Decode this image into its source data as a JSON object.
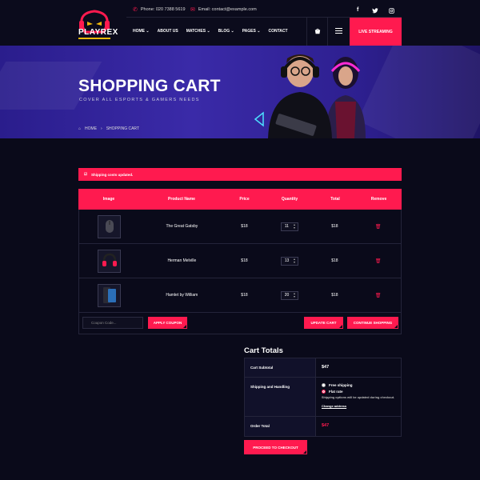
{
  "brand": {
    "name": "PLAYREX"
  },
  "topbar": {
    "phone": "Phone: 020 7388 5619",
    "email": "Email: contact@example.com",
    "social": [
      "facebook-icon",
      "twitter-icon",
      "instagram-icon"
    ]
  },
  "nav": {
    "items": [
      "HOME",
      "ABOUT US",
      "MATCHES",
      "BLOG",
      "PAGES",
      "CONTACT"
    ],
    "live_label": "LIVE STREAMING"
  },
  "hero": {
    "title": "SHOPPING CART",
    "subtitle": "COVER ALL ESPORTS & GAMERS NEEDS",
    "breadcrumb": {
      "home": "HOME",
      "current": "SHOPPING CART"
    }
  },
  "notice": "Shipping costs updated.",
  "cart": {
    "headers": [
      "Image",
      "Product Name",
      "Price",
      "Quantity",
      "Total",
      "Remove"
    ],
    "rows": [
      {
        "name": "The Great Gatsby",
        "price": "$18",
        "qty": "11",
        "total": "$18",
        "icon": "mouse-icon"
      },
      {
        "name": "Herman Melville",
        "price": "$18",
        "qty": "13",
        "total": "$18",
        "icon": "headset-icon"
      },
      {
        "name": "Hamlet by William",
        "price": "$18",
        "qty": "20",
        "total": "$18",
        "icon": "phone-icon"
      }
    ],
    "coupon_placeholder": "Coupon Code...",
    "apply_label": "APPLY COUPON",
    "update_label": "UPDATE CART",
    "continue_label": "CONTINUE SHOPPING"
  },
  "totals": {
    "title": "Cart Totals",
    "subtotal_label": "Cart Subtotal",
    "subtotal_value": "$47",
    "shipping_label": "Shipping and Handling",
    "options": [
      "Free shipping",
      "Flat rate"
    ],
    "selected_option": "Flat rate",
    "note": "Shipping options will be updated during checkout.",
    "change_label": "Change address",
    "order_label": "Order Total",
    "order_value": "$47",
    "checkout_label": "PROCEED TO CHECKOUT"
  },
  "colors": {
    "accent": "#ff1a4f",
    "background": "#0a0a1a",
    "hero": "#3a2aa8",
    "logo_bar": "#f0b90b"
  }
}
